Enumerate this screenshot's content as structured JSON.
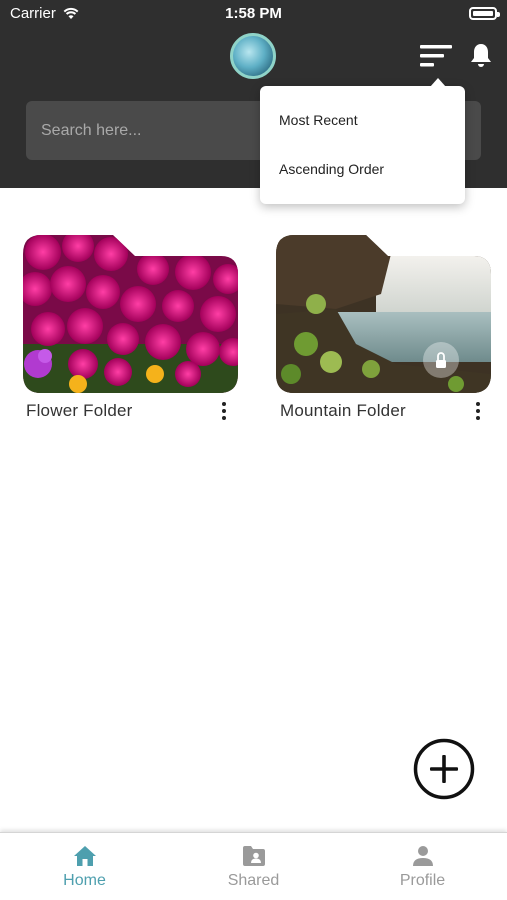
{
  "status_bar": {
    "carrier": "Carrier",
    "time": "1:58 PM"
  },
  "header": {
    "search_placeholder": "Search here..."
  },
  "sort_menu": {
    "items": [
      "Most Recent",
      "Ascending Order"
    ]
  },
  "folders": [
    {
      "name": "Flower Folder",
      "locked": false
    },
    {
      "name": "Mountain Folder",
      "locked": true
    }
  ],
  "tabs": [
    {
      "label": "Home",
      "icon": "home-icon",
      "active": true
    },
    {
      "label": "Shared",
      "icon": "shared-folder-icon",
      "active": false
    },
    {
      "label": "Profile",
      "icon": "person-icon",
      "active": false
    }
  ],
  "colors": {
    "header_bg": "#2f2f2f",
    "active_tab": "#4e9fae",
    "inactive_tab": "#9a9a9a"
  }
}
